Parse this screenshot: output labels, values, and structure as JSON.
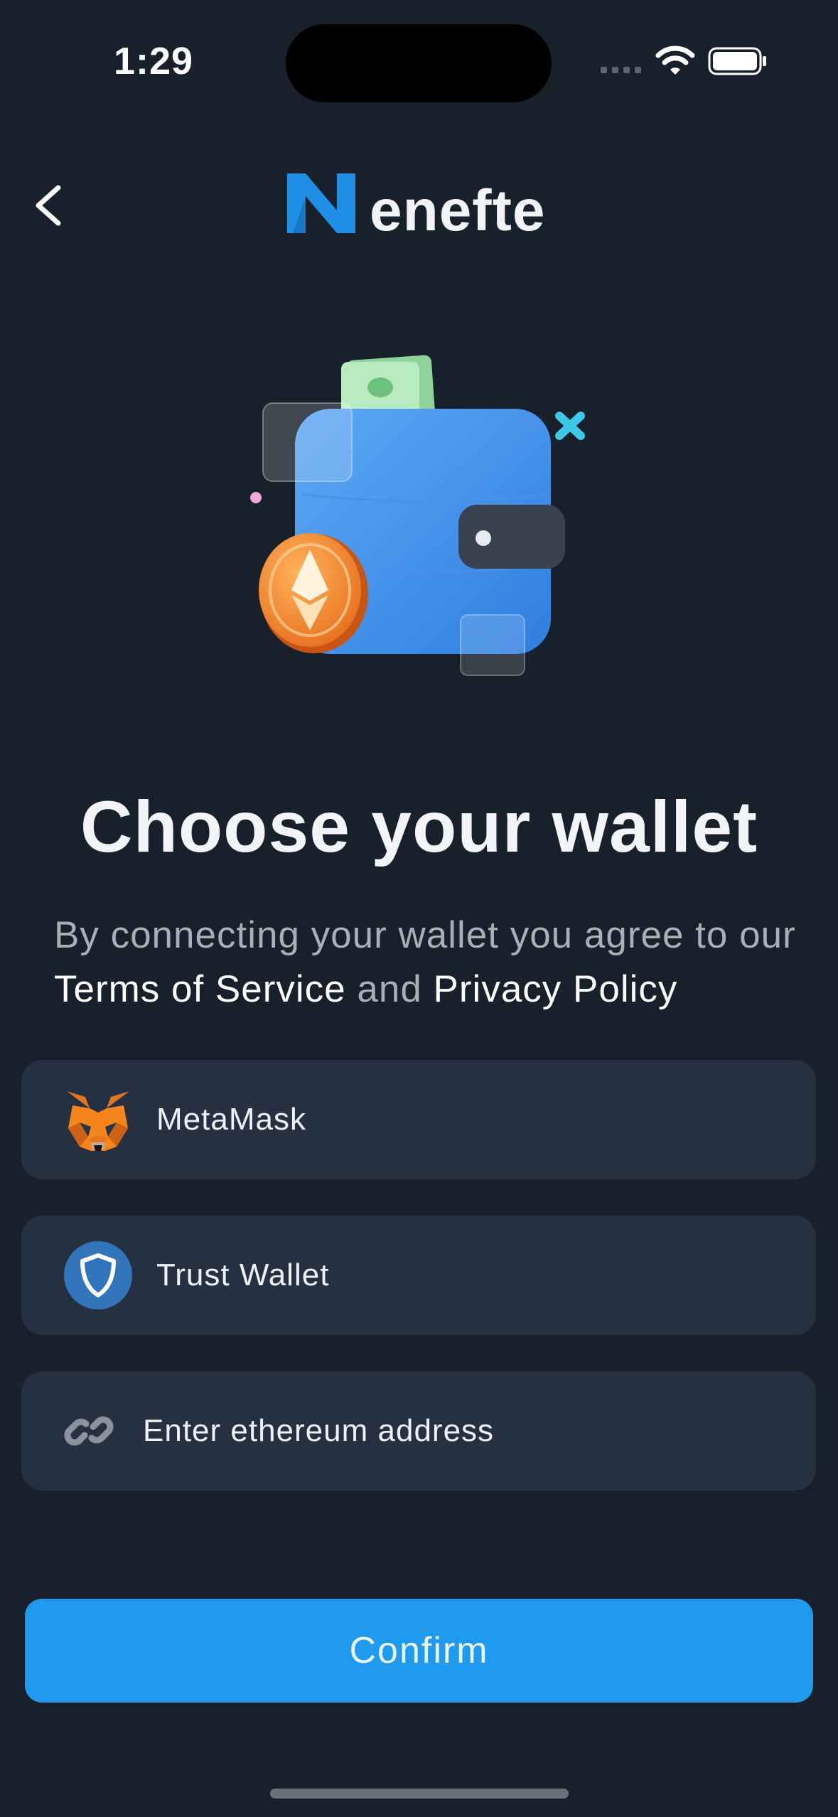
{
  "status_bar": {
    "time": "1:29"
  },
  "header": {
    "logo_text": "enefte"
  },
  "main": {
    "title": "Choose your wallet",
    "subtitle_part1": "By connecting your wallet you agree to our ",
    "terms_label": "Terms of Service",
    "subtitle_and": " and ",
    "privacy_label": "Privacy Policy"
  },
  "wallets": [
    {
      "label": "MetaMask",
      "icon": "metamask-fox-icon"
    },
    {
      "label": "Trust Wallet",
      "icon": "trust-wallet-shield-icon"
    },
    {
      "label": "Enter ethereum address",
      "icon": "link-icon"
    }
  ],
  "confirm_label": "Confirm",
  "colors": {
    "background": "#18202b",
    "card": "#253141",
    "accent": "#1f9aef"
  }
}
